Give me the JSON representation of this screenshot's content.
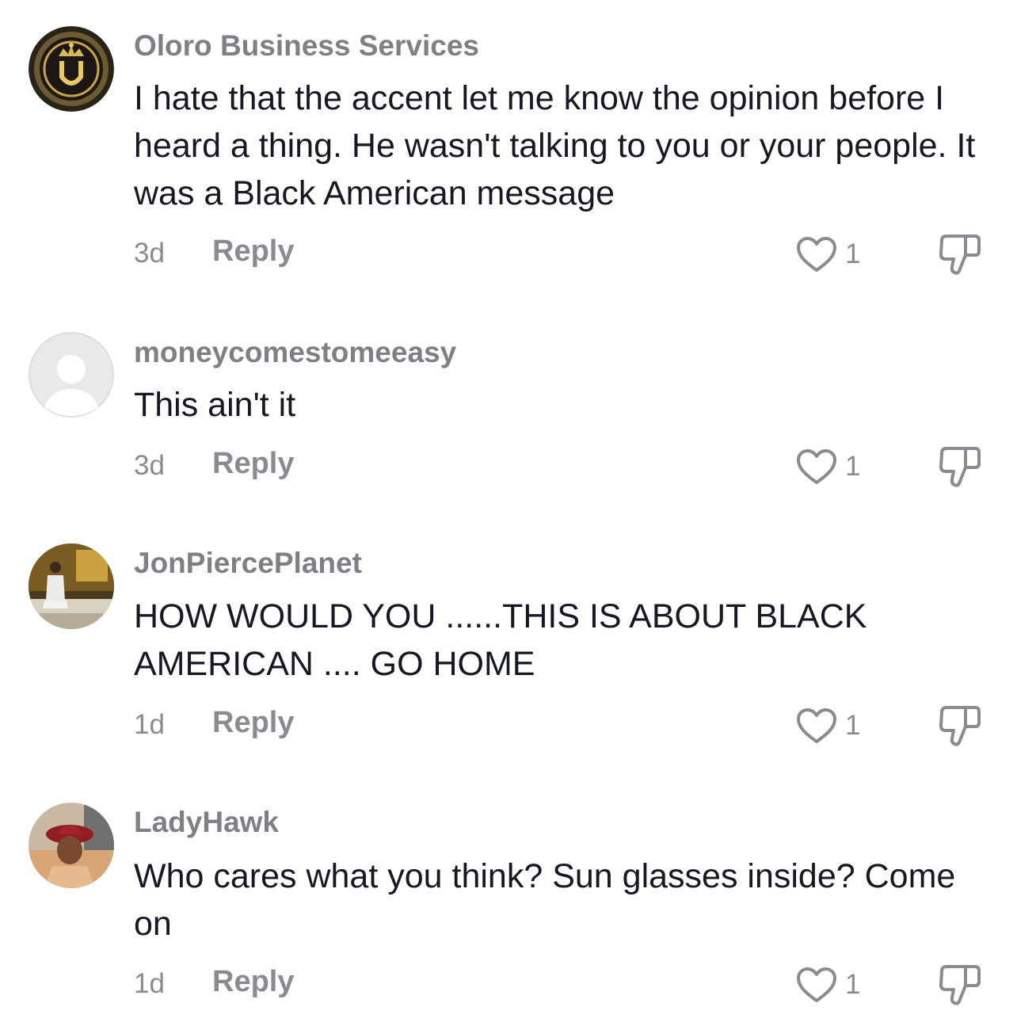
{
  "comments": [
    {
      "username": "Oloro Business Services",
      "avatar_icon": "crown-logo-avatar",
      "text": "I hate that the accent let me know the opinion before I heard a thing. He wasn't talking to you or your people. It was a Black American message",
      "timestamp": "3d",
      "reply_label": "Reply",
      "likes": "1"
    },
    {
      "username": "moneycomestomeeasy",
      "avatar_icon": "default-user-avatar",
      "text": "This ain't it",
      "timestamp": "3d",
      "reply_label": "Reply",
      "likes": "1"
    },
    {
      "username": "JonPiercePlanet",
      "avatar_icon": "photo-avatar",
      "text": "HOW WOULD YOU ......THIS IS ABOUT BLACK AMERICAN .... GO HOME",
      "timestamp": "1d",
      "reply_label": "Reply",
      "likes": "1"
    },
    {
      "username": "LadyHawk",
      "avatar_icon": "photo-avatar",
      "text": "Who cares what you think? Sun glasses inside? Come on",
      "timestamp": "1d",
      "reply_label": "Reply",
      "likes": "1"
    }
  ],
  "icons": {
    "like": "heart-outline-icon",
    "dislike": "thumbs-down-icon"
  },
  "colors": {
    "username": "#7f7f85",
    "text": "#161823",
    "secondary": "#8a8b91"
  }
}
